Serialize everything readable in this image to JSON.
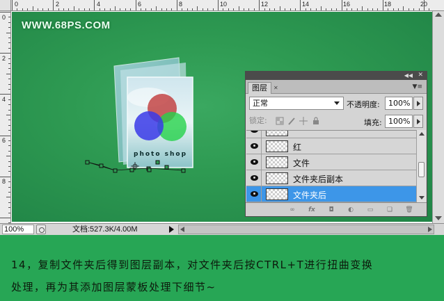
{
  "canvas": {
    "watermark": "WWW.68PS.COM",
    "art_label": "photo shop"
  },
  "rulers": {
    "top": [
      "0",
      "2",
      "4",
      "6",
      "8",
      "10",
      "12",
      "14",
      "16",
      "18",
      "20"
    ],
    "left": [
      "0",
      "2",
      "4",
      "6",
      "8"
    ]
  },
  "status": {
    "zoom": "100%",
    "doc_info": "文档:527.3K/4.00M"
  },
  "panel": {
    "tab": "图层",
    "blend_mode": "正常",
    "opacity_label": "不透明度:",
    "opacity_value": "100%",
    "lock_label": "锁定:",
    "fill_label": "填充:",
    "fill_value": "100%",
    "layers": [
      {
        "name": "",
        "selected": false
      },
      {
        "name": "红",
        "selected": false
      },
      {
        "name": "文件",
        "selected": false
      },
      {
        "name": "文件夹后副本",
        "selected": false
      },
      {
        "name": "文件夹后",
        "selected": true
      }
    ],
    "footer_icons": [
      "link-icon",
      "fx-icon",
      "mask-icon",
      "adjustment-icon",
      "folder-icon",
      "new-layer-icon",
      "trash-icon"
    ]
  },
  "caption": {
    "line1": "14，复制文件夹后得到图层副本，对文件夹后按CTRL+T进行扭曲变换",
    "line2": "处理，再为其添加图层蒙板处理下细节~"
  },
  "colors": {
    "canvas_green": "#2e9a52",
    "caption_green": "#27a655",
    "selection_blue": "#3d96e8"
  }
}
